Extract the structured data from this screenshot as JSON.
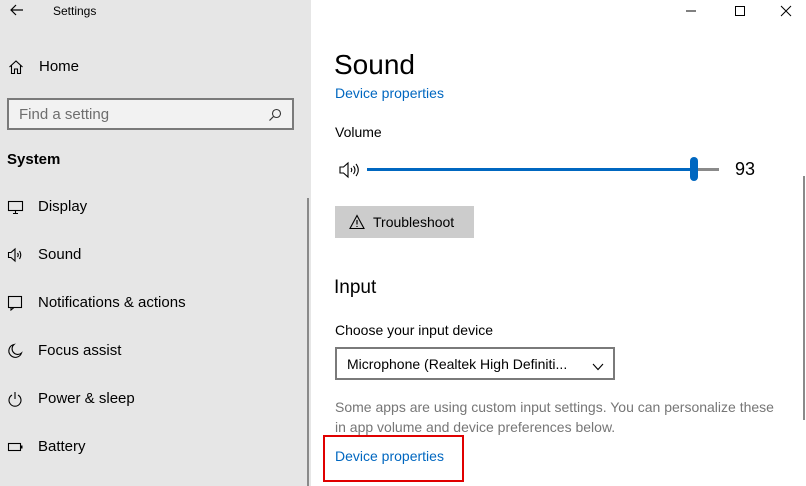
{
  "window": {
    "title": "Settings",
    "controls": [
      "minimize",
      "maximize",
      "close"
    ]
  },
  "sidebar": {
    "home_label": "Home",
    "search_placeholder": "Find a setting",
    "section_title": "System",
    "items": [
      {
        "label": "Display",
        "icon": "display-icon"
      },
      {
        "label": "Sound",
        "icon": "speaker-icon"
      },
      {
        "label": "Notifications & actions",
        "icon": "notification-icon"
      },
      {
        "label": "Focus assist",
        "icon": "moon-icon"
      },
      {
        "label": "Power & sleep",
        "icon": "power-icon"
      },
      {
        "label": "Battery",
        "icon": "battery-icon"
      }
    ]
  },
  "main": {
    "title": "Sound",
    "output_device_properties_link": "Device properties",
    "volume": {
      "label": "Volume",
      "value": "93",
      "level": 0.93
    },
    "troubleshoot_label": "Troubleshoot",
    "input_heading": "Input",
    "input_device_label": "Choose your input device",
    "input_device_value": "Microphone (Realtek High Definiti...",
    "custom_settings_note": "Some apps are using custom input settings. You can personalize these in app volume and device preferences below.",
    "input_device_properties_link": "Device properties"
  },
  "colors": {
    "accent": "#0067c0",
    "sidebar_bg": "#e6e6e6",
    "highlight": "#e00000"
  }
}
